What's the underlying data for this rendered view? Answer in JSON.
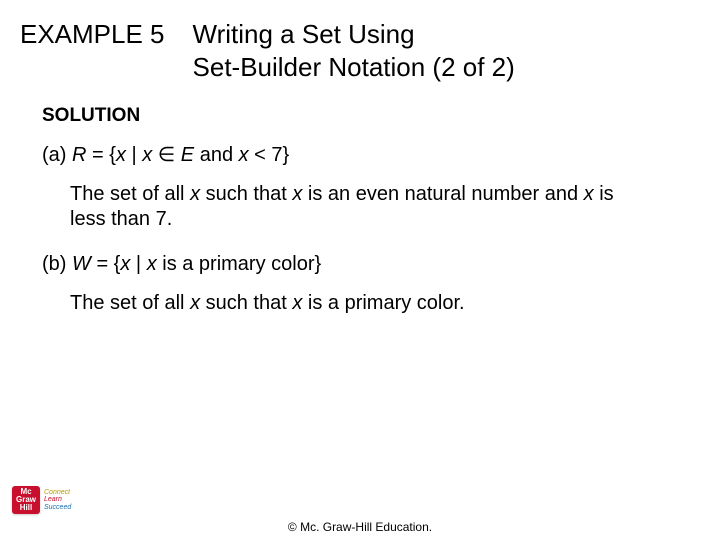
{
  "header": {
    "example_label": "EXAMPLE 5",
    "title_line1": "Writing a Set Using",
    "title_line2": "Set-Builder Notation (2 of 2)"
  },
  "solution_label": "SOLUTION",
  "part_a": {
    "prefix": "(a) ",
    "var_R": "R",
    "eq": " = {",
    "x1": "x",
    "bar": " | ",
    "x2": "x",
    "in": " ∈ ",
    "E": "E",
    "and": " and ",
    "x3": "x",
    "lt": " < 7}",
    "explain_pre": "The set of all ",
    "explain_x1": "x",
    "explain_mid1": " such that ",
    "explain_x2": "x",
    "explain_mid2": " is an even natural number and ",
    "explain_x3": "x",
    "explain_post": " is less than 7."
  },
  "part_b": {
    "prefix": "(b)  ",
    "var_W": "W",
    "eq": " = {",
    "x1": "x",
    "bar": " | ",
    "x2": "x",
    "post": " is a primary color}",
    "explain_pre": "The set of all ",
    "explain_x1": "x",
    "explain_mid": " such that ",
    "explain_x2": "x",
    "explain_post": " is a primary color."
  },
  "footer": {
    "copyright": "© Mc. Graw-Hill Education.",
    "logo_top": "Mc",
    "logo_mid": "Graw",
    "logo_bot": "Hill",
    "tag1": "Connect",
    "tag2": "Learn",
    "tag3": "Succeed"
  }
}
